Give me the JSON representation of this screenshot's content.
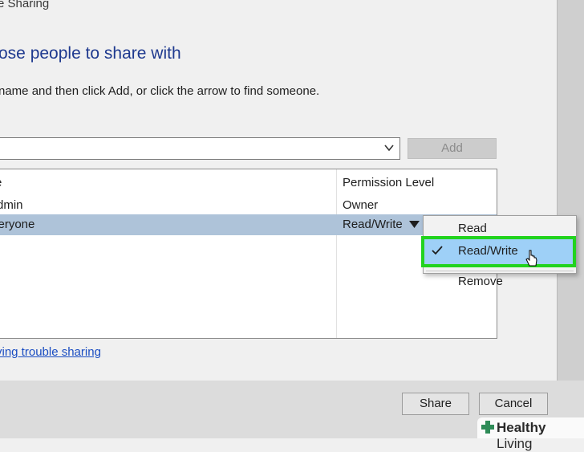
{
  "window": {
    "title_fragment": "e Sharing"
  },
  "heading": "ose people to share with",
  "instructions": " name and then click Add, or click the arrow to find someone.",
  "add_button": "Add",
  "table": {
    "columns": [
      "e",
      "Permission Level"
    ],
    "rows": [
      {
        "name": "dmin",
        "permission": "Owner"
      },
      {
        "name": "veryone",
        "permission": "Read/Write"
      }
    ]
  },
  "context_menu": {
    "items": [
      "Read",
      "Read/Write",
      "Remove"
    ],
    "checked": "Read/Write"
  },
  "trouble_link": "ving trouble sharing",
  "footer": {
    "share": "Share",
    "cancel": "Cancel"
  },
  "watermark": {
    "brand_bold": "Healthy",
    "brand_light": " Living"
  },
  "colors": {
    "heading": "#1f3a8f",
    "selected_row": "#aec3d9",
    "menu_highlight": "#9ed0f7",
    "highlight_outline": "#22d31e",
    "link": "#1a4dc2"
  }
}
